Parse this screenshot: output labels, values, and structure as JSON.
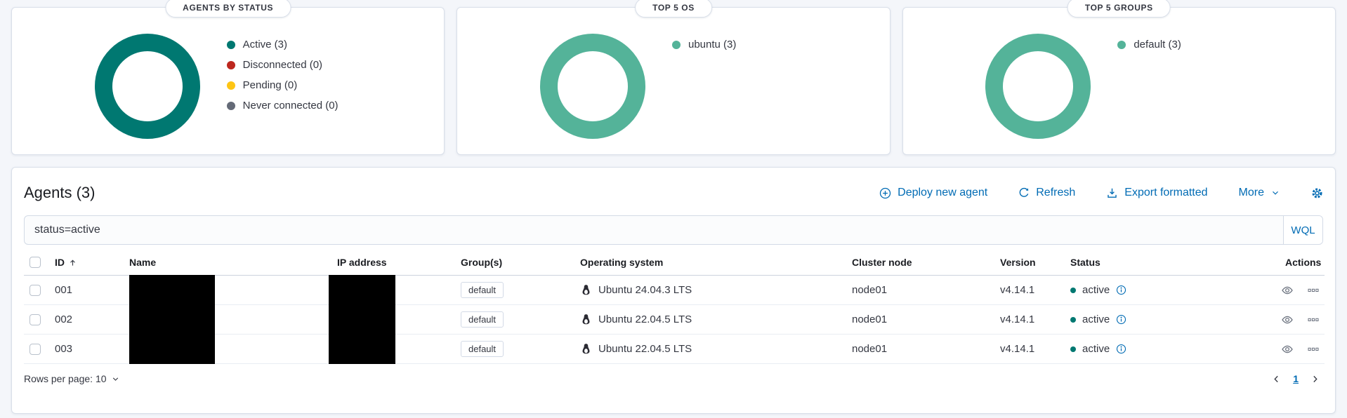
{
  "colors": {
    "accent_blue": "#006BB4",
    "active_teal": "#007871",
    "disconnected_red": "#BD271E",
    "pending_yellow": "#FEC514",
    "never_connected_gray": "#646A77",
    "vis_green": "#54B399"
  },
  "status_panels": [
    {
      "title": "AGENTS BY STATUS",
      "donut": {
        "color": "#007871"
      },
      "legend": [
        {
          "label": "Active (3)",
          "color": "#007871"
        },
        {
          "label": "Disconnected (0)",
          "color": "#BD271E"
        },
        {
          "label": "Pending (0)",
          "color": "#FEC514"
        },
        {
          "label": "Never connected (0)",
          "color": "#646A77"
        }
      ]
    },
    {
      "title": "TOP 5 OS",
      "donut": {
        "color": "#54B399"
      },
      "legend": [
        {
          "label": "ubuntu (3)",
          "color": "#54B399"
        }
      ]
    },
    {
      "title": "TOP 5 GROUPS",
      "donut": {
        "color": "#54B399"
      },
      "legend": [
        {
          "label": "default (3)",
          "color": "#54B399"
        }
      ]
    }
  ],
  "chart_data": [
    {
      "type": "pie",
      "title": "AGENTS BY STATUS",
      "labels": [
        "Active",
        "Disconnected",
        "Pending",
        "Never connected"
      ],
      "values": [
        3,
        0,
        0,
        0
      ],
      "colors": [
        "#007871",
        "#BD271E",
        "#FEC514",
        "#646A77"
      ],
      "donut": true,
      "legend_position": "right"
    },
    {
      "type": "pie",
      "title": "TOP 5 OS",
      "labels": [
        "ubuntu"
      ],
      "values": [
        3
      ],
      "colors": [
        "#54B399"
      ],
      "donut": true,
      "legend_position": "right"
    },
    {
      "type": "pie",
      "title": "TOP 5 GROUPS",
      "labels": [
        "default"
      ],
      "values": [
        3
      ],
      "colors": [
        "#54B399"
      ],
      "donut": true,
      "legend_position": "right"
    }
  ],
  "agents": {
    "title": "Agents (3)",
    "toolbar": {
      "deploy_label": "Deploy new agent",
      "refresh_label": "Refresh",
      "export_label": "Export formatted",
      "more_label": "More"
    },
    "search": {
      "value": "status=active",
      "wql_label": "WQL"
    },
    "table": {
      "columns": {
        "id": "ID",
        "name": "Name",
        "ip": "IP address",
        "groups": "Group(s)",
        "os": "Operating system",
        "cluster": "Cluster node",
        "version": "Version",
        "status": "Status",
        "actions": "Actions"
      },
      "rows": [
        {
          "id": "001",
          "group": "default",
          "os": "Ubuntu 24.04.3 LTS",
          "cluster_node": "node01",
          "version": "v4.14.1",
          "status": "active"
        },
        {
          "id": "002",
          "group": "default",
          "os": "Ubuntu 22.04.5 LTS",
          "cluster_node": "node01",
          "version": "v4.14.1",
          "status": "active"
        },
        {
          "id": "003",
          "group": "default",
          "os": "Ubuntu 22.04.5 LTS",
          "cluster_node": "node01",
          "version": "v4.14.1",
          "status": "active"
        }
      ]
    },
    "footer": {
      "rows_per_page_label": "Rows per page: 10",
      "page": "1"
    }
  }
}
